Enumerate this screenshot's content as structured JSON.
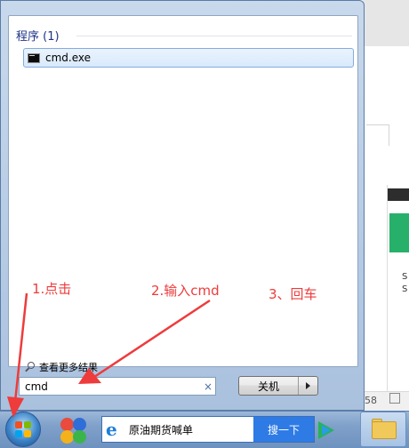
{
  "start_menu": {
    "group_header": "程序 (1)",
    "results": [
      {
        "label": "cmd.exe",
        "icon": "console-icon"
      }
    ],
    "more_results_label": "查看更多结果",
    "search": {
      "value": "cmd",
      "clear_glyph": "×"
    },
    "shutdown": {
      "label": "关机",
      "arrow_glyph": "▸"
    }
  },
  "taskbar": {
    "search_text": "原油期货喊单",
    "search_button": "搜一下"
  },
  "background": {
    "side_text_1": "S",
    "side_text_2": "S",
    "bottom_text": "58"
  },
  "annotations": {
    "step1": "1.点击",
    "step2": "2.输入cmd",
    "step3": "3、回车",
    "color": "#ee3b3b"
  }
}
